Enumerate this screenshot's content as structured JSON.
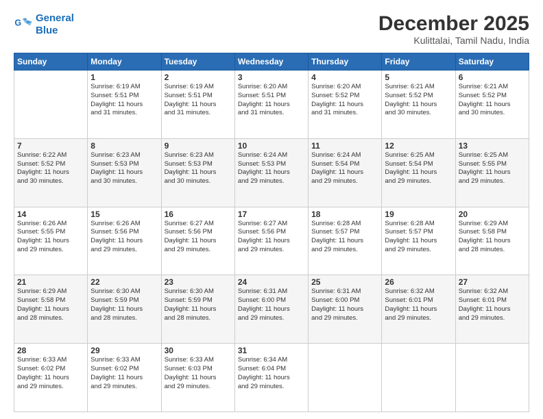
{
  "logo": {
    "line1": "General",
    "line2": "Blue"
  },
  "title": "December 2025",
  "subtitle": "Kulittalai, Tamil Nadu, India",
  "days_of_week": [
    "Sunday",
    "Monday",
    "Tuesday",
    "Wednesday",
    "Thursday",
    "Friday",
    "Saturday"
  ],
  "weeks": [
    [
      {
        "day": "",
        "info": ""
      },
      {
        "day": "1",
        "info": "Sunrise: 6:19 AM\nSunset: 5:51 PM\nDaylight: 11 hours\nand 31 minutes."
      },
      {
        "day": "2",
        "info": "Sunrise: 6:19 AM\nSunset: 5:51 PM\nDaylight: 11 hours\nand 31 minutes."
      },
      {
        "day": "3",
        "info": "Sunrise: 6:20 AM\nSunset: 5:51 PM\nDaylight: 11 hours\nand 31 minutes."
      },
      {
        "day": "4",
        "info": "Sunrise: 6:20 AM\nSunset: 5:52 PM\nDaylight: 11 hours\nand 31 minutes."
      },
      {
        "day": "5",
        "info": "Sunrise: 6:21 AM\nSunset: 5:52 PM\nDaylight: 11 hours\nand 30 minutes."
      },
      {
        "day": "6",
        "info": "Sunrise: 6:21 AM\nSunset: 5:52 PM\nDaylight: 11 hours\nand 30 minutes."
      }
    ],
    [
      {
        "day": "7",
        "info": "Sunrise: 6:22 AM\nSunset: 5:52 PM\nDaylight: 11 hours\nand 30 minutes."
      },
      {
        "day": "8",
        "info": "Sunrise: 6:23 AM\nSunset: 5:53 PM\nDaylight: 11 hours\nand 30 minutes."
      },
      {
        "day": "9",
        "info": "Sunrise: 6:23 AM\nSunset: 5:53 PM\nDaylight: 11 hours\nand 30 minutes."
      },
      {
        "day": "10",
        "info": "Sunrise: 6:24 AM\nSunset: 5:53 PM\nDaylight: 11 hours\nand 29 minutes."
      },
      {
        "day": "11",
        "info": "Sunrise: 6:24 AM\nSunset: 5:54 PM\nDaylight: 11 hours\nand 29 minutes."
      },
      {
        "day": "12",
        "info": "Sunrise: 6:25 AM\nSunset: 5:54 PM\nDaylight: 11 hours\nand 29 minutes."
      },
      {
        "day": "13",
        "info": "Sunrise: 6:25 AM\nSunset: 5:55 PM\nDaylight: 11 hours\nand 29 minutes."
      }
    ],
    [
      {
        "day": "14",
        "info": "Sunrise: 6:26 AM\nSunset: 5:55 PM\nDaylight: 11 hours\nand 29 minutes."
      },
      {
        "day": "15",
        "info": "Sunrise: 6:26 AM\nSunset: 5:56 PM\nDaylight: 11 hours\nand 29 minutes."
      },
      {
        "day": "16",
        "info": "Sunrise: 6:27 AM\nSunset: 5:56 PM\nDaylight: 11 hours\nand 29 minutes."
      },
      {
        "day": "17",
        "info": "Sunrise: 6:27 AM\nSunset: 5:56 PM\nDaylight: 11 hours\nand 29 minutes."
      },
      {
        "day": "18",
        "info": "Sunrise: 6:28 AM\nSunset: 5:57 PM\nDaylight: 11 hours\nand 29 minutes."
      },
      {
        "day": "19",
        "info": "Sunrise: 6:28 AM\nSunset: 5:57 PM\nDaylight: 11 hours\nand 29 minutes."
      },
      {
        "day": "20",
        "info": "Sunrise: 6:29 AM\nSunset: 5:58 PM\nDaylight: 11 hours\nand 28 minutes."
      }
    ],
    [
      {
        "day": "21",
        "info": "Sunrise: 6:29 AM\nSunset: 5:58 PM\nDaylight: 11 hours\nand 28 minutes."
      },
      {
        "day": "22",
        "info": "Sunrise: 6:30 AM\nSunset: 5:59 PM\nDaylight: 11 hours\nand 28 minutes."
      },
      {
        "day": "23",
        "info": "Sunrise: 6:30 AM\nSunset: 5:59 PM\nDaylight: 11 hours\nand 28 minutes."
      },
      {
        "day": "24",
        "info": "Sunrise: 6:31 AM\nSunset: 6:00 PM\nDaylight: 11 hours\nand 29 minutes."
      },
      {
        "day": "25",
        "info": "Sunrise: 6:31 AM\nSunset: 6:00 PM\nDaylight: 11 hours\nand 29 minutes."
      },
      {
        "day": "26",
        "info": "Sunrise: 6:32 AM\nSunset: 6:01 PM\nDaylight: 11 hours\nand 29 minutes."
      },
      {
        "day": "27",
        "info": "Sunrise: 6:32 AM\nSunset: 6:01 PM\nDaylight: 11 hours\nand 29 minutes."
      }
    ],
    [
      {
        "day": "28",
        "info": "Sunrise: 6:33 AM\nSunset: 6:02 PM\nDaylight: 11 hours\nand 29 minutes."
      },
      {
        "day": "29",
        "info": "Sunrise: 6:33 AM\nSunset: 6:02 PM\nDaylight: 11 hours\nand 29 minutes."
      },
      {
        "day": "30",
        "info": "Sunrise: 6:33 AM\nSunset: 6:03 PM\nDaylight: 11 hours\nand 29 minutes."
      },
      {
        "day": "31",
        "info": "Sunrise: 6:34 AM\nSunset: 6:04 PM\nDaylight: 11 hours\nand 29 minutes."
      },
      {
        "day": "",
        "info": ""
      },
      {
        "day": "",
        "info": ""
      },
      {
        "day": "",
        "info": ""
      }
    ]
  ]
}
